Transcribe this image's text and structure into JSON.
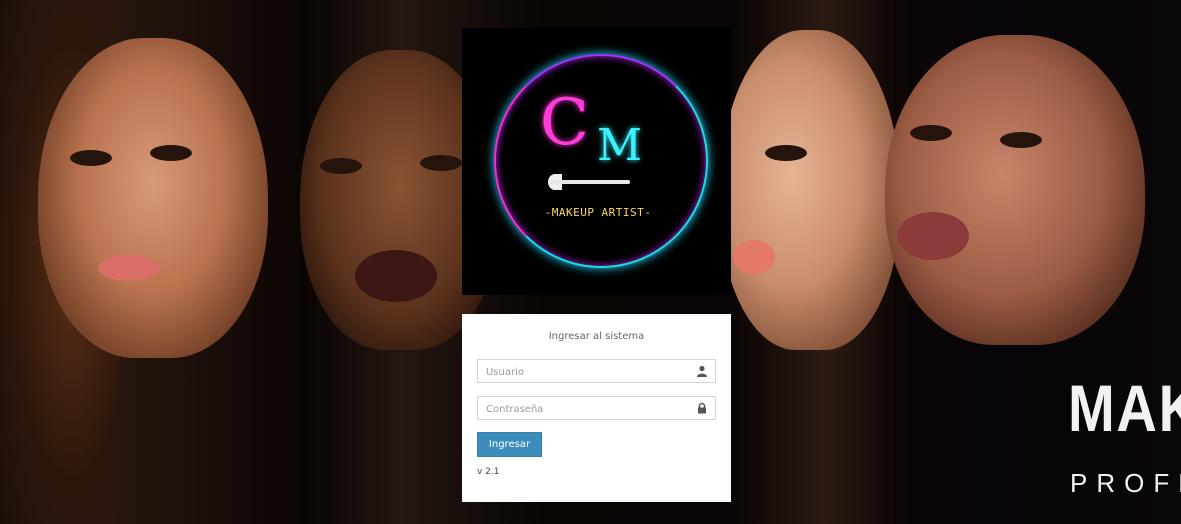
{
  "logo": {
    "letter_c": "C",
    "letter_m": "M",
    "tagline": "-MAKEUP ARTIST-",
    "ring_colors": [
      "#ff2bd0",
      "#9a3aff",
      "#18e0e6"
    ]
  },
  "background": {
    "brand_big": "MAK",
    "brand_small": "PROFE"
  },
  "login": {
    "title": "Ingresar al sistema",
    "username_placeholder": "Usuario",
    "username_value": "",
    "username_icon": "user-icon",
    "password_placeholder": "Contraseña",
    "password_value": "",
    "password_icon": "lock-icon",
    "submit_label": "Ingresar",
    "version": "v 2.1",
    "accent_color": "#3c8dbc"
  }
}
